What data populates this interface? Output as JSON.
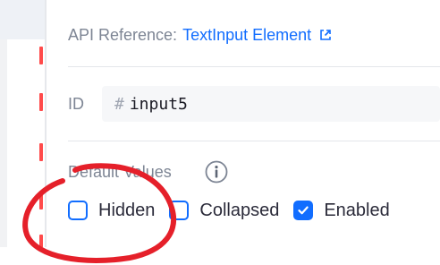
{
  "panel": {
    "api_label": "API Reference:",
    "api_link": "TextInput Element",
    "id_label": "ID",
    "id_hash": "#",
    "id_value": "input5",
    "defaults_label": "Default Values"
  },
  "checkboxes": [
    {
      "label": "Hidden",
      "checked": false
    },
    {
      "label": "Collapsed",
      "checked": false
    },
    {
      "label": "Enabled",
      "checked": true
    }
  ],
  "colors": {
    "accent": "#116dff",
    "annotation": "#e5202a",
    "guide_dash": "#ff4b4b"
  },
  "icons": {
    "external_link": "external-link-icon",
    "info": "info-icon",
    "check": "checkmark-icon"
  }
}
